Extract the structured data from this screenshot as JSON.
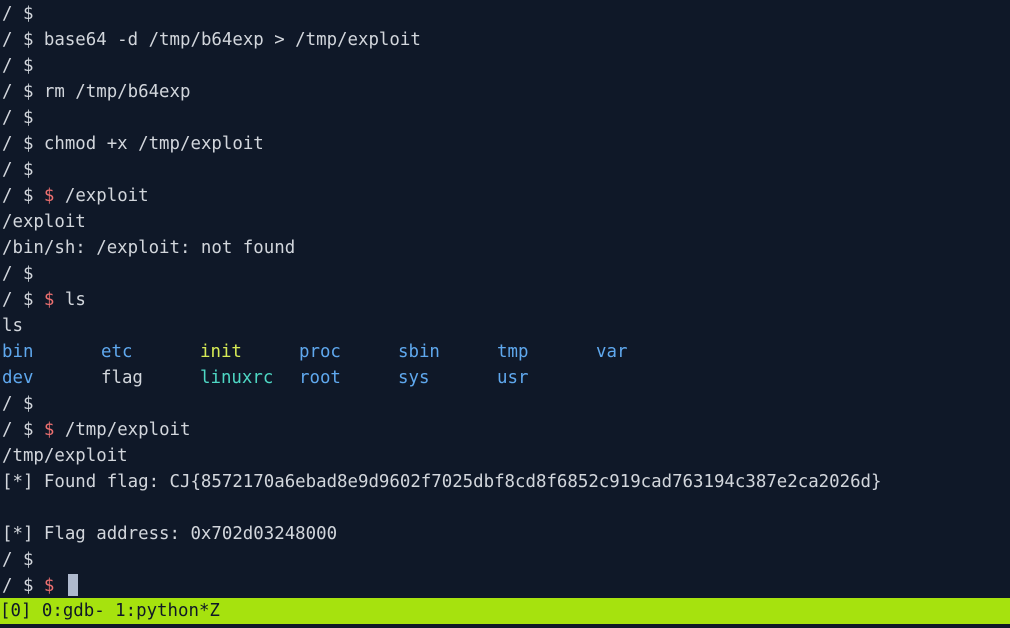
{
  "terminal": {
    "lines": [
      {
        "prompt": "/ $",
        "cmd": ""
      },
      {
        "prompt": "/ $",
        "cmd": " base64 -d /tmp/b64exp > /tmp/exploit"
      },
      {
        "prompt": "/ $",
        "cmd": ""
      },
      {
        "prompt": "/ $",
        "cmd": " rm /tmp/b64exp"
      },
      {
        "prompt": "/ $",
        "cmd": ""
      },
      {
        "prompt": "/ $",
        "cmd": " chmod +x /tmp/exploit"
      },
      {
        "prompt": "/ $",
        "cmd": ""
      },
      {
        "prompt": "/ $ ",
        "dollar": "$",
        "cmd": " /exploit"
      },
      {
        "text": "/exploit"
      },
      {
        "text": "/bin/sh: /exploit: not found"
      },
      {
        "prompt": "/ $",
        "cmd": ""
      },
      {
        "prompt": "/ $ ",
        "dollar": "$",
        "cmd": " ls"
      },
      {
        "text": "ls"
      },
      {
        "ls_row": 0
      },
      {
        "ls_row": 1
      },
      {
        "prompt": "/ $",
        "cmd": ""
      },
      {
        "prompt": "/ $ ",
        "dollar": "$",
        "cmd": " /tmp/exploit"
      },
      {
        "text": "/tmp/exploit"
      },
      {
        "text": "[*] Found flag: CJ{8572170a6ebad8e9d9602f7025dbf8cd8f6852c919cad763194c387e2ca2026d}"
      },
      {
        "text": ""
      },
      {
        "text": "[*] Flag address: 0x702d03248000"
      },
      {
        "prompt": "/ $",
        "cmd": ""
      },
      {
        "prompt": "/ $ ",
        "dollar": "$",
        "cmd": " ",
        "cursor": true
      }
    ],
    "ls_rows": [
      [
        {
          "name": "bin",
          "kind": "dir"
        },
        {
          "name": "etc",
          "kind": "dir"
        },
        {
          "name": "init",
          "kind": "exe"
        },
        {
          "name": "proc",
          "kind": "dir"
        },
        {
          "name": "sbin",
          "kind": "dir"
        },
        {
          "name": "tmp",
          "kind": "dir"
        },
        {
          "name": "var",
          "kind": "dir"
        }
      ],
      [
        {
          "name": "dev",
          "kind": "dir"
        },
        {
          "name": "flag",
          "kind": "file"
        },
        {
          "name": "linuxrc",
          "kind": "link"
        },
        {
          "name": "root",
          "kind": "dir"
        },
        {
          "name": "sys",
          "kind": "dir"
        },
        {
          "name": "usr",
          "kind": "dir"
        }
      ]
    ]
  },
  "statusbar": {
    "session": "[0]",
    "windows": " 0:gdb- 1:python*Z"
  },
  "colors": {
    "background": "#0f1828",
    "foreground": "#d2d6dc",
    "directory": "#5fa8ee",
    "executable": "#d6ea55",
    "symlink": "#4ed7c4",
    "prompt_dollar": "#ee7070",
    "statusbar": "#a6e20e"
  }
}
